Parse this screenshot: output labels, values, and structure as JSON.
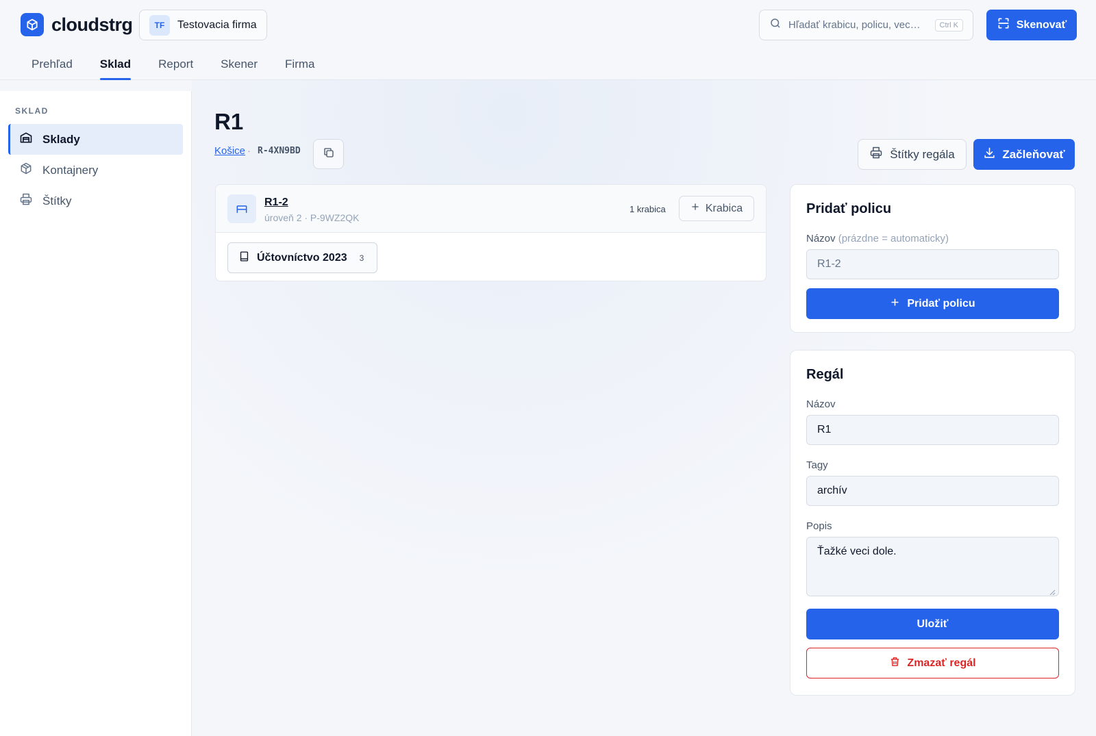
{
  "header": {
    "brand": "cloudstrg",
    "company": {
      "initials": "TF",
      "name": "Testovacia firma"
    },
    "search": {
      "placeholder": "Hľadať krabicu, policu, vec…",
      "shortcut": "Ctrl K"
    },
    "scan_label": "Skenovať",
    "tabs": [
      {
        "label": "Prehľad",
        "active": false
      },
      {
        "label": "Sklad",
        "active": true
      },
      {
        "label": "Report",
        "active": false
      },
      {
        "label": "Skener",
        "active": false
      },
      {
        "label": "Firma",
        "active": false
      }
    ]
  },
  "sidebar": {
    "section_title": "SKLAD",
    "items": [
      {
        "label": "Sklady",
        "icon": "warehouse-icon",
        "active": true
      },
      {
        "label": "Kontajnery",
        "icon": "cube-icon",
        "active": false
      },
      {
        "label": "Štítky",
        "icon": "printer-icon",
        "active": false
      }
    ]
  },
  "rack": {
    "title": "R1",
    "location_link": "Košice",
    "separator": "·",
    "code": "R-4XN9BD",
    "labels_button": "Štítky regála",
    "file_button": "Začleňovať"
  },
  "shelf": {
    "name": "R1-2",
    "meta": "úroveň 2 · P-9WZ2QK",
    "count": "1 krabica",
    "add_box_label": "Krabica",
    "boxes": [
      {
        "name": "Účtovníctvo 2023",
        "count": "3"
      }
    ]
  },
  "add_shelf_panel": {
    "title": "Pridať policu",
    "name_label": "Názov",
    "name_hint": "(prázdne = automaticky)",
    "name_placeholder": "R1-2",
    "submit_label": "Pridať policu"
  },
  "rack_panel": {
    "title": "Regál",
    "name_label": "Názov",
    "name_value": "R1",
    "tags_label": "Tagy",
    "tags_value": "archív",
    "description_label": "Popis",
    "description_value": "Ťažké veci dole.",
    "save_label": "Uložiť",
    "delete_label": "Zmazať regál"
  },
  "colors": {
    "accent": "#2563eb",
    "danger": "#dc2626",
    "active_bg": "#e5edfb"
  }
}
